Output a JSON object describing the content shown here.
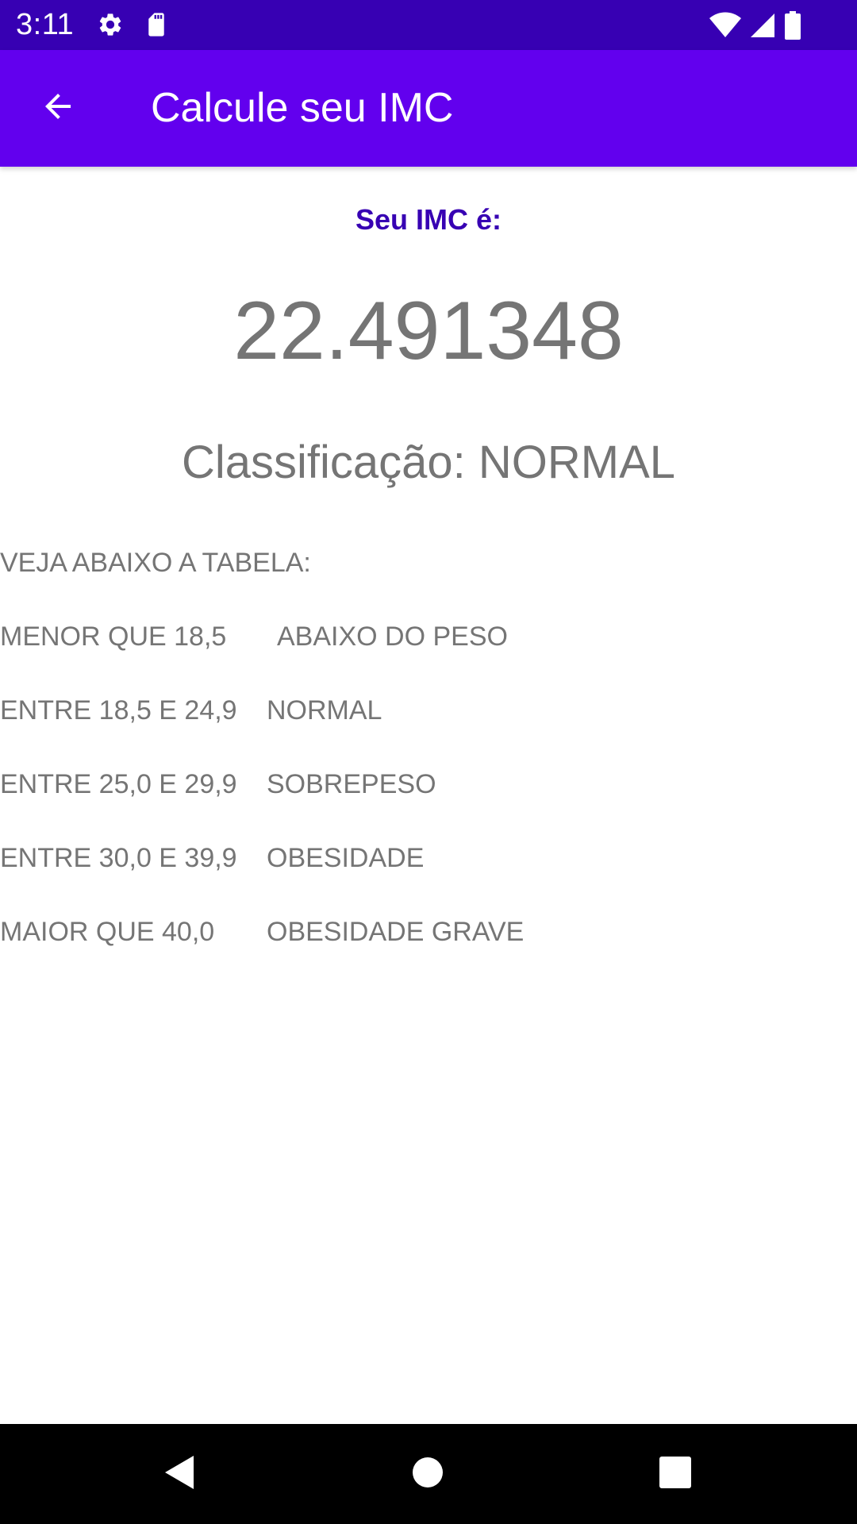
{
  "status_bar": {
    "time": "3:11",
    "left_icons": [
      "settings-gear-icon",
      "sd-card-icon"
    ],
    "right_icons": [
      "wifi-icon",
      "cell-signal-icon",
      "battery-icon"
    ],
    "background_color": "#3700b3"
  },
  "app_bar": {
    "title": "Calcule seu IMC",
    "back_icon": "arrow-back-icon",
    "background_color": "#6200ee"
  },
  "result": {
    "label": "Seu IMC é:",
    "value": "22.491348",
    "classification_prefix": "Classificação:",
    "classification_value": "NORMAL",
    "label_color": "#3700b3",
    "text_color": "#757575"
  },
  "table": {
    "title": "VEJA ABAIXO A TABELA:",
    "rows": [
      {
        "range": "MENOR QUE 18,5",
        "classification": "ABAIXO DO PESO"
      },
      {
        "range": "ENTRE 18,5 E 24,9",
        "classification": "NORMAL"
      },
      {
        "range": "ENTRE 25,0 E 29,9",
        "classification": "SOBREPESO"
      },
      {
        "range": "ENTRE 30,0 E 39,9",
        "classification": "OBESIDADE"
      },
      {
        "range": "MAIOR QUE 40,0",
        "classification": "OBESIDADE GRAVE"
      }
    ]
  },
  "nav_bar": {
    "buttons": [
      "back-triangle-icon",
      "home-circle-icon",
      "recents-square-icon"
    ]
  }
}
